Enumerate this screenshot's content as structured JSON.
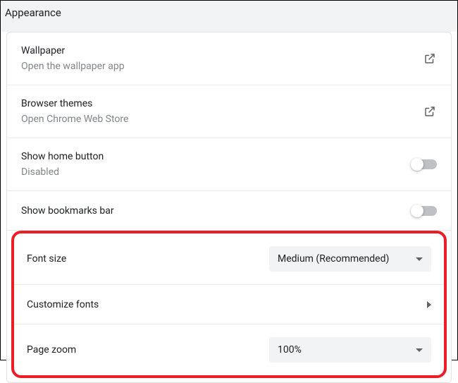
{
  "header": {
    "title": "Appearance"
  },
  "rows": {
    "wallpaper": {
      "title": "Wallpaper",
      "sub": "Open the wallpaper app"
    },
    "themes": {
      "title": "Browser themes",
      "sub": "Open Chrome Web Store"
    },
    "home": {
      "title": "Show home button",
      "sub": "Disabled"
    },
    "bookmarks": {
      "title": "Show bookmarks bar"
    },
    "fontsize": {
      "title": "Font size",
      "value": "Medium (Recommended)"
    },
    "customfonts": {
      "title": "Customize fonts"
    },
    "pagezoom": {
      "title": "Page zoom",
      "value": "100%"
    }
  }
}
